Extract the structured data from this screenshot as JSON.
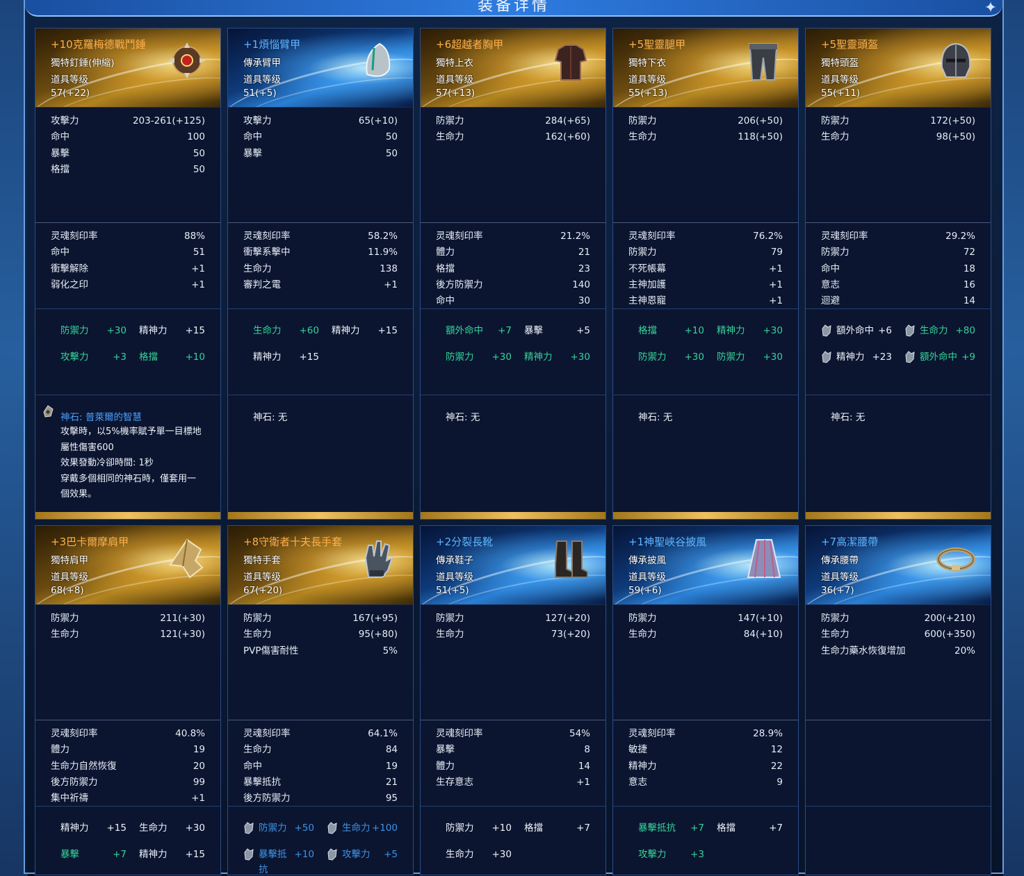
{
  "window": {
    "title": "装备详情"
  },
  "labels": {
    "stone_prefix": "神石: "
  },
  "cards": [
    {
      "name": "+10克羅梅德戰鬥錘",
      "rarity": "gold",
      "type": "獨特釘錘(伸縮)",
      "level_label": "道具等级",
      "level": "57(+22)",
      "icon": "mace-icon",
      "base": [
        [
          "攻擊力",
          "203-261(+125)"
        ],
        [
          "命中",
          "100"
        ],
        [
          "暴擊",
          "50"
        ],
        [
          "格擋",
          "50"
        ]
      ],
      "soul": [
        [
          "灵魂刻印率",
          "88%"
        ],
        [
          "命中",
          "51"
        ],
        [
          "衝擊解除",
          "+1"
        ],
        [
          "弱化之印",
          "+1"
        ]
      ],
      "bonus": [
        {
          "k": "防禦力",
          "v": "+30",
          "c": "green"
        },
        {
          "k": "精神力",
          "v": "+15",
          "c": "white"
        },
        {
          "k": "攻擊力",
          "v": "+3",
          "c": "green"
        },
        {
          "k": "格擋",
          "v": "+10",
          "c": "green"
        }
      ],
      "stone": {
        "name": "神石: 普萊爾的智慧",
        "named": true,
        "desc": [
          "攻擊時，以5%機率賦予單一目標地",
          "屬性傷害600",
          "效果發動冷卻時間: 1秒",
          "穿戴多個相同的神石時，僅套用一",
          "個效果。"
        ]
      }
    },
    {
      "name": "+1煩惱臂甲",
      "rarity": "blue",
      "type": "傳承臂甲",
      "level_label": "道具等级",
      "level": "51(+5)",
      "icon": "guard-icon",
      "base": [
        [
          "攻擊力",
          "65(+10)"
        ],
        [
          "命中",
          "50"
        ],
        [
          "暴擊",
          "50"
        ]
      ],
      "soul": [
        [
          "灵魂刻印率",
          "58.2%"
        ],
        [
          "衝擊系擊中",
          "11.9%"
        ],
        [
          "生命力",
          "138"
        ],
        [
          "審判之電",
          "+1"
        ]
      ],
      "bonus": [
        {
          "k": "生命力",
          "v": "+60",
          "c": "green"
        },
        {
          "k": "精神力",
          "v": "+15",
          "c": "white"
        },
        {
          "k": "精神力",
          "v": "+15",
          "c": "white"
        }
      ],
      "stone": {
        "name": "神石: 无",
        "named": false,
        "desc": []
      }
    },
    {
      "name": "+6超越者胸甲",
      "rarity": "gold",
      "type": "獨特上衣",
      "level_label": "道具等级",
      "level": "57(+13)",
      "icon": "chest-armor-icon",
      "base": [
        [
          "防禦力",
          "284(+65)"
        ],
        [
          "生命力",
          "162(+60)"
        ]
      ],
      "soul": [
        [
          "灵魂刻印率",
          "21.2%"
        ],
        [
          "體力",
          "21"
        ],
        [
          "格擋",
          "23"
        ],
        [
          "後方防禦力",
          "140"
        ],
        [
          "命中",
          "30"
        ]
      ],
      "bonus": [
        {
          "k": "額外命中",
          "v": "+7",
          "c": "green"
        },
        {
          "k": "暴擊",
          "v": "+5",
          "c": "white"
        },
        {
          "k": "防禦力",
          "v": "+30",
          "c": "green"
        },
        {
          "k": "精神力",
          "v": "+30",
          "c": "green"
        }
      ],
      "stone": {
        "name": "神石: 无",
        "named": false,
        "desc": []
      }
    },
    {
      "name": "+5聖靈腿甲",
      "rarity": "gold",
      "type": "獨特下衣",
      "level_label": "道具等级",
      "level": "55(+13)",
      "icon": "leg-armor-icon",
      "base": [
        [
          "防禦力",
          "206(+50)"
        ],
        [
          "生命力",
          "118(+50)"
        ]
      ],
      "soul": [
        [
          "灵魂刻印率",
          "76.2%"
        ],
        [
          "防禦力",
          "79"
        ],
        [
          "不死帳幕",
          "+1"
        ],
        [
          "主神加護",
          "+1"
        ],
        [
          "主神恩寵",
          "+1"
        ]
      ],
      "bonus": [
        {
          "k": "格擋",
          "v": "+10",
          "c": "green"
        },
        {
          "k": "精神力",
          "v": "+30",
          "c": "green"
        },
        {
          "k": "防禦力",
          "v": "+30",
          "c": "green"
        },
        {
          "k": "防禦力",
          "v": "+30",
          "c": "green"
        }
      ],
      "stone": {
        "name": "神石: 无",
        "named": false,
        "desc": []
      }
    },
    {
      "name": "+5聖靈頭盔",
      "rarity": "gold",
      "type": "獨特頭盔",
      "level_label": "道具等级",
      "level": "55(+11)",
      "icon": "helmet-icon",
      "base": [
        [
          "防禦力",
          "172(+50)"
        ],
        [
          "生命力",
          "98(+50)"
        ]
      ],
      "soul": [
        [
          "灵魂刻印率",
          "29.2%"
        ],
        [
          "防禦力",
          "72"
        ],
        [
          "命中",
          "18"
        ],
        [
          "意志",
          "16"
        ],
        [
          "迴避",
          "14"
        ]
      ],
      "bonus": [
        {
          "k": "額外命中",
          "v": "+6",
          "c": "white",
          "gem": true
        },
        {
          "k": "生命力",
          "v": "+80",
          "c": "green",
          "gem": true
        },
        {
          "k": "精神力",
          "v": "+23",
          "c": "white",
          "gem": true
        },
        {
          "k": "額外命中",
          "v": "+9",
          "c": "green",
          "gem": true
        }
      ],
      "stone": {
        "name": "神石: 无",
        "named": false,
        "desc": []
      }
    },
    {
      "name": "+3巴卡爾摩肩甲",
      "rarity": "gold",
      "type": "獨特肩甲",
      "level_label": "道具等级",
      "level": "68(+8)",
      "icon": "shoulder-icon",
      "base": [
        [
          "防禦力",
          "211(+30)"
        ],
        [
          "生命力",
          "121(+30)"
        ]
      ],
      "soul": [
        [
          "灵魂刻印率",
          "40.8%"
        ],
        [
          "體力",
          "19"
        ],
        [
          "生命力自然恢復",
          "20"
        ],
        [
          "後方防禦力",
          "99"
        ],
        [
          "集中祈禱",
          "+1"
        ]
      ],
      "bonus": [
        {
          "k": "精神力",
          "v": "+15",
          "c": "white"
        },
        {
          "k": "生命力",
          "v": "+30",
          "c": "white"
        },
        {
          "k": "暴擊",
          "v": "+7",
          "c": "green"
        },
        {
          "k": "精神力",
          "v": "+15",
          "c": "white"
        }
      ]
    },
    {
      "name": "+8守衛者十夫長手套",
      "rarity": "gold",
      "type": "獨特手套",
      "level_label": "道具等级",
      "level": "67(+20)",
      "icon": "glove-icon",
      "base": [
        [
          "防禦力",
          "167(+95)"
        ],
        [
          "生命力",
          "95(+80)"
        ],
        [
          "PVP傷害耐性",
          "5%"
        ]
      ],
      "soul": [
        [
          "灵魂刻印率",
          "64.1%"
        ],
        [
          "生命力",
          "84"
        ],
        [
          "命中",
          "19"
        ],
        [
          "暴擊抵抗",
          "21"
        ],
        [
          "後方防禦力",
          "95"
        ]
      ],
      "bonus": [
        {
          "k": "防禦力",
          "v": "+50",
          "c": "blue",
          "gem": true
        },
        {
          "k": "生命力",
          "v": "+100",
          "c": "blue",
          "gem": true
        },
        {
          "k": "暴擊抵抗",
          "v": "+10",
          "c": "blue",
          "gem": true
        },
        {
          "k": "攻擊力",
          "v": "+5",
          "c": "blue",
          "gem": true
        }
      ]
    },
    {
      "name": "+2分裂長靴",
      "rarity": "blue",
      "type": "傳承鞋子",
      "level_label": "道具等级",
      "level": "51(+5)",
      "icon": "boots-icon",
      "base": [
        [
          "防禦力",
          "127(+20)"
        ],
        [
          "生命力",
          "73(+20)"
        ]
      ],
      "soul": [
        [
          "灵魂刻印率",
          "54%"
        ],
        [
          "暴擊",
          "8"
        ],
        [
          "體力",
          "14"
        ],
        [
          "生存意志",
          "+1"
        ]
      ],
      "bonus": [
        {
          "k": "防禦力",
          "v": "+10",
          "c": "white"
        },
        {
          "k": "格擋",
          "v": "+7",
          "c": "white"
        },
        {
          "k": "生命力",
          "v": "+30",
          "c": "white"
        }
      ]
    },
    {
      "name": "+1神聖峽谷披風",
      "rarity": "blue",
      "type": "傳承披風",
      "level_label": "道具等级",
      "level": "59(+6)",
      "icon": "cape-icon",
      "base": [
        [
          "防禦力",
          "147(+10)"
        ],
        [
          "生命力",
          "84(+10)"
        ]
      ],
      "soul": [
        [
          "灵魂刻印率",
          "28.9%"
        ],
        [
          "敏捷",
          "12"
        ],
        [
          "精神力",
          "22"
        ],
        [
          "意志",
          "9"
        ]
      ],
      "bonus": [
        {
          "k": "暴擊抵抗",
          "v": "+7",
          "c": "green"
        },
        {
          "k": "格擋",
          "v": "+7",
          "c": "white"
        },
        {
          "k": "攻擊力",
          "v": "+3",
          "c": "green"
        }
      ]
    },
    {
      "name": "+7高潔腰帶",
      "rarity": "blue",
      "type": "傳承腰帶",
      "level_label": "道具等级",
      "level": "36(+7)",
      "icon": "belt-icon",
      "base": [
        [
          "防禦力",
          "200(+210)"
        ],
        [
          "生命力",
          "600(+350)"
        ],
        [
          "生命力藥水恢復增加",
          "20%"
        ]
      ],
      "soul": [],
      "bonus": []
    }
  ]
}
